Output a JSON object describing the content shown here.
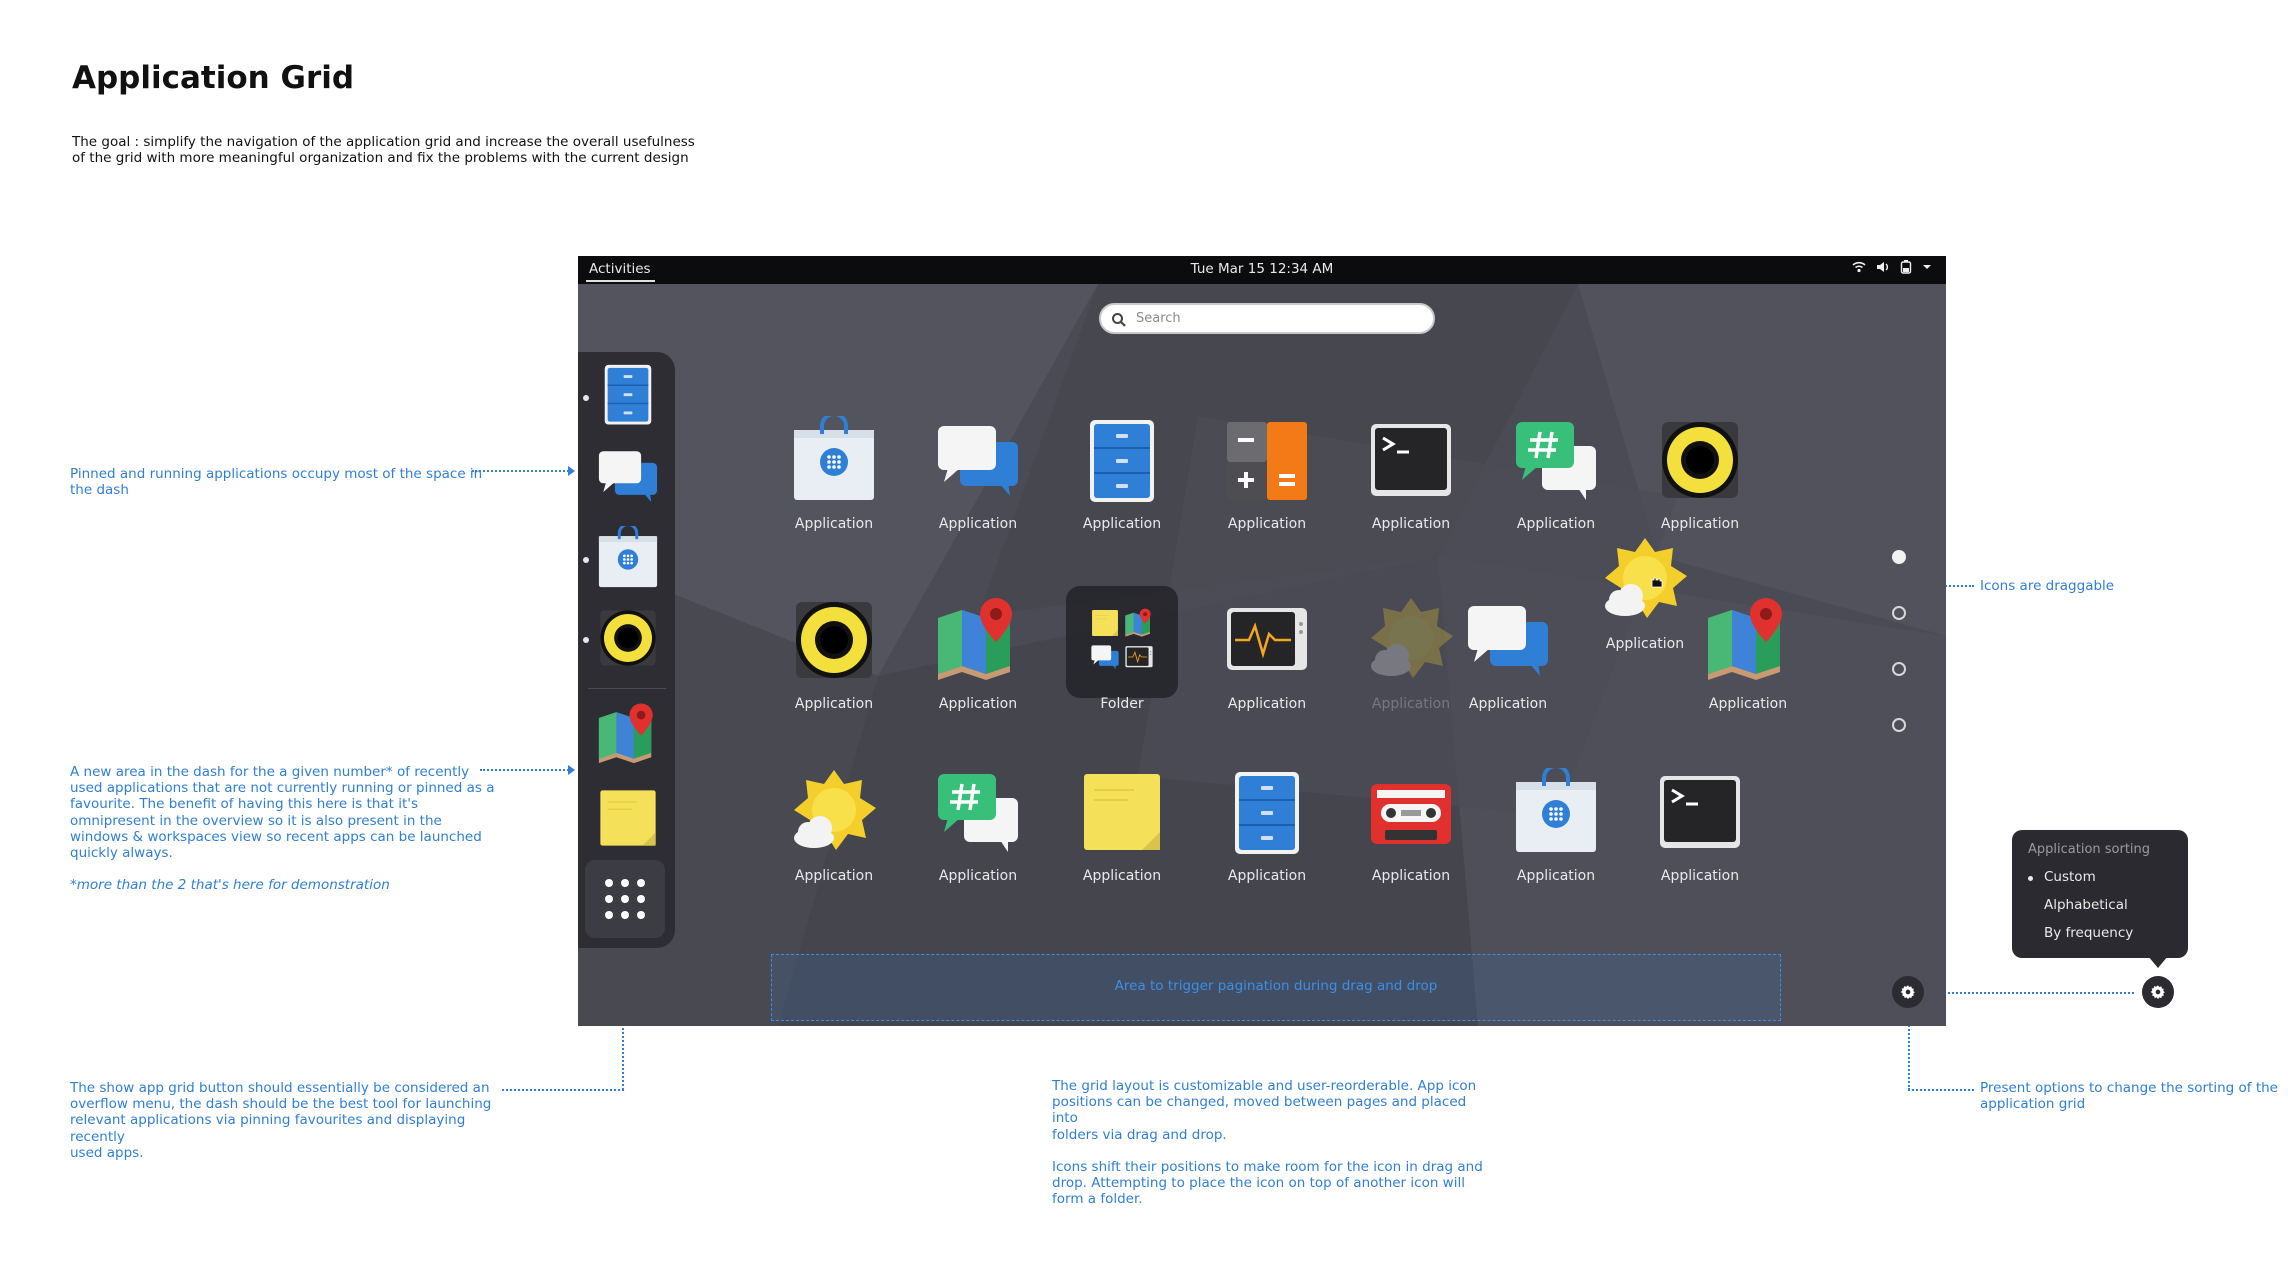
{
  "doc": {
    "title": "Application Grid",
    "subtitle_line1": "The goal : simplify the navigation of the application grid and increase the overall usefulness",
    "subtitle_line2": "of the grid with more meaningful organization and fix the problems with the current design"
  },
  "topbar": {
    "activities": "Activities",
    "clock": "Tue Mar 15  12:34 AM"
  },
  "search": {
    "placeholder": "Search"
  },
  "grid": {
    "row1": [
      {
        "label": "Application",
        "icon": "store-bag-icon"
      },
      {
        "label": "Application",
        "icon": "chat-icon"
      },
      {
        "label": "Application",
        "icon": "file-cabinet-icon"
      },
      {
        "label": "Application",
        "icon": "calculator-icon"
      },
      {
        "label": "Application",
        "icon": "terminal-icon"
      },
      {
        "label": "Application",
        "icon": "hashtag-chat-icon"
      },
      {
        "label": "Application",
        "icon": "speaker-icon"
      }
    ],
    "row2": [
      {
        "label": "Application",
        "icon": "speaker-icon"
      },
      {
        "label": "Application",
        "icon": "maps-icon"
      },
      {
        "label": "Folder",
        "icon": "folder-icon"
      },
      {
        "label": "Application",
        "icon": "system-monitor-icon"
      },
      {
        "label": "Application",
        "icon": "weather-icon"
      },
      {
        "label": "Application",
        "icon": "chat-icon"
      },
      {
        "label": "Application",
        "icon": "maps-icon"
      }
    ],
    "dragged": {
      "label": "Application",
      "icon": "weather-icon"
    },
    "row3": [
      {
        "label": "Application",
        "icon": "weather-icon"
      },
      {
        "label": "Application",
        "icon": "hashtag-chat-icon"
      },
      {
        "label": "Application",
        "icon": "sticky-notes-icon"
      },
      {
        "label": "Application",
        "icon": "file-cabinet-icon"
      },
      {
        "label": "Application",
        "icon": "tape-recorder-icon"
      },
      {
        "label": "Application",
        "icon": "store-bag-icon"
      },
      {
        "label": "Application",
        "icon": "terminal-icon"
      }
    ]
  },
  "trigger_area": "Area to trigger pagination during drag and drop",
  "sort_menu": {
    "header": "Application sorting",
    "items": [
      "Custom",
      "Alphabetical",
      "By frequency"
    ],
    "selected": "Custom"
  },
  "annotations": {
    "pinned_1": "Pinned and running applications occupy most of the space in",
    "pinned_2": "the dash",
    "recent_1": "A new area in the dash for the a given number* of recently",
    "recent_2": "used applications that are not currently running or pinned as a",
    "recent_3": "favourite. The benefit of having this here is that it's",
    "recent_4": "omnipresent in the overview so it is also present in the",
    "recent_5": "windows & workspaces view so recent apps can be launched",
    "recent_6": "quickly always.",
    "recent_note": "*more than the 2 that's here for demonstration",
    "showapps_1": "The show app grid button should essentially be considered an",
    "showapps_2": "overflow menu, the dash should be the best tool for launching",
    "showapps_3": "relevant applications via pinning favourites and displaying recently",
    "showapps_4": "used apps.",
    "grid_1": "The grid layout is customizable and user-reorderable. App icon",
    "grid_2": "positions can be changed, moved between pages and placed into",
    "grid_3": "folders via drag and drop.",
    "grid_4": "Icons shift their positions to make room for the icon in drag and",
    "grid_5": "drop. Attempting to place the icon on top of another icon will",
    "grid_6": "form a folder.",
    "draggable": "Icons are draggable",
    "sorting_1": "Present options to change the sorting of the",
    "sorting_2": "application grid"
  }
}
